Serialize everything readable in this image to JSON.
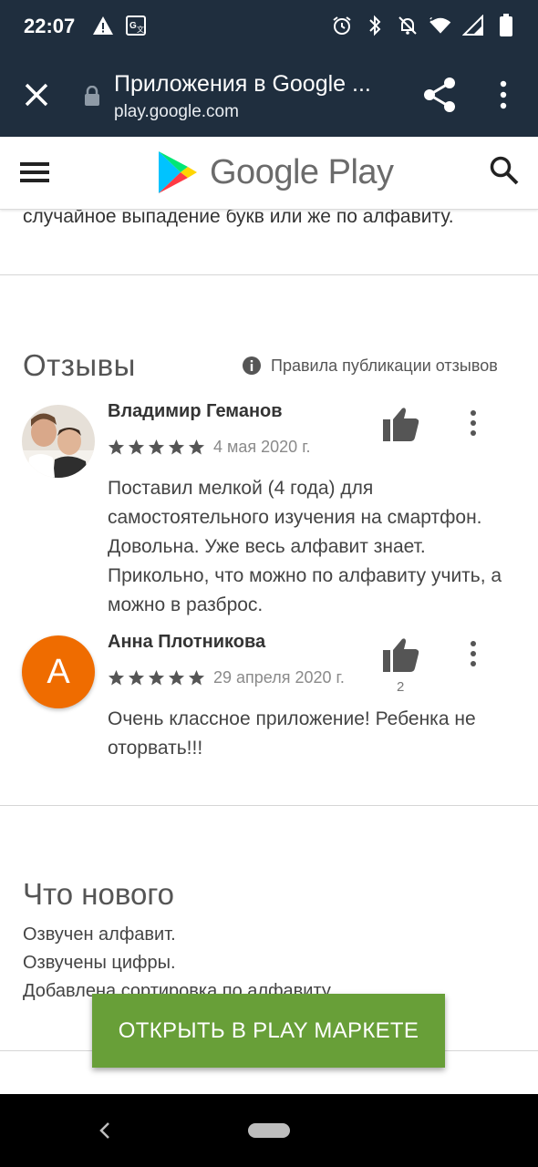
{
  "status_bar": {
    "time": "22:07",
    "left_icons": [
      "warning-icon",
      "translate-icon"
    ],
    "right_icons": [
      "alarm-icon",
      "bluetooth-icon",
      "notifications-off-icon",
      "wifi-icon",
      "signal-icon",
      "battery-icon"
    ]
  },
  "browser": {
    "title": "Приложения в Google ...",
    "url": "play.google.com"
  },
  "store_header": {
    "brand": "Google Play"
  },
  "description_tail": "случайное выпадение букв или же по алфавиту.",
  "reviews": {
    "heading": "Отзывы",
    "policy_link": "Правила публикации отзывов",
    "items": [
      {
        "author": "Владимир Геманов",
        "rating": 5,
        "date": "4 мая 2020 г.",
        "text": "Поставил мелкой (4 года) для самостоятельного изучения на смартфон. Довольна. Уже весь алфавит знает. Прикольно, что можно по алфавиту учить, а можно в разброс.",
        "helpful_count": ""
      },
      {
        "author": "Анна Плотникова",
        "avatar_letter": "А",
        "rating": 5,
        "date": "29 апреля 2020 г.",
        "text": "Очень классное приложение! Ребенка не оторвать!!!",
        "helpful_count": "2"
      }
    ]
  },
  "whats_new": {
    "heading": "Что нового",
    "lines": [
      "Озвучен алфавит.",
      "Озвучены цифры.",
      "Добавлена сортировка по алфавиту."
    ]
  },
  "open_button": "ОТКРЫТЬ В PLAY МАРКЕТЕ",
  "colors": {
    "toolbar_bg": "#1f2e3e",
    "button_green": "#689f38",
    "avatar_orange": "#ef6c00"
  }
}
